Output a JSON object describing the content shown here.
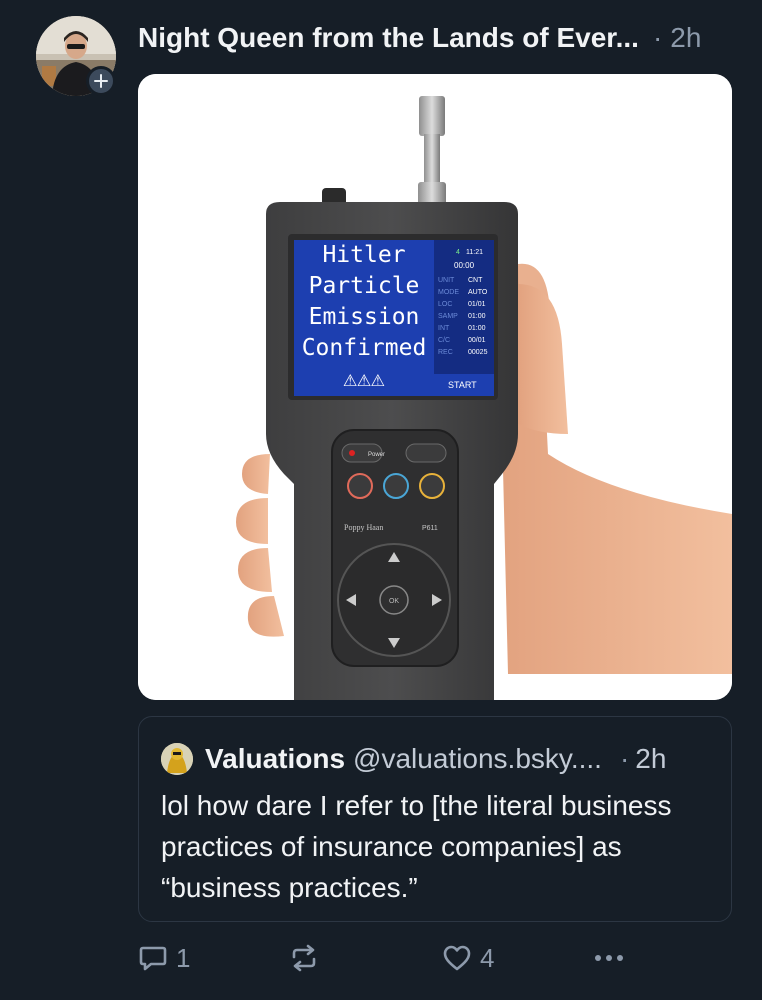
{
  "post": {
    "author_display_name": "Night Queen from the Lands of Ever...",
    "separator": "·",
    "time": "2h"
  },
  "media": {
    "device_screen_lines": [
      "Hitler",
      "Particle",
      "Emission",
      "Confirmed",
      "⚠⚠⚠"
    ],
    "device_status": [
      "4",
      "11:21",
      "00:00",
      "UNIT",
      "CNT",
      "MODE",
      "AUTO",
      "LOC",
      "01/01",
      "SAMP",
      "01:00",
      "INT",
      "01:00",
      "C/C",
      "00/01",
      "REC",
      "00025",
      "START"
    ],
    "device_brand": "Poppy Haan",
    "device_model": "P611",
    "device_power_label": "Power",
    "device_ok_label": "OK"
  },
  "quote": {
    "display_name": "Valuations",
    "handle": "@valuations.bsky....",
    "separator": "·",
    "time": "2h",
    "text": "lol how dare I refer to [the literal business practices of insurance companies] as “business practices.”"
  },
  "actions": {
    "reply_count": "1",
    "repost_count": "",
    "like_count": "4"
  },
  "icons": {
    "reply": "speech-bubble-icon",
    "repost": "repost-arrows-icon",
    "like": "heart-icon",
    "more": "ellipsis-icon",
    "follow": "plus-icon"
  },
  "colors": {
    "background": "#161e27",
    "muted_text": "#8d9aab",
    "primary_text": "#f1f3f5",
    "border": "#2c3643",
    "device_screen": "#1d3fb0"
  }
}
